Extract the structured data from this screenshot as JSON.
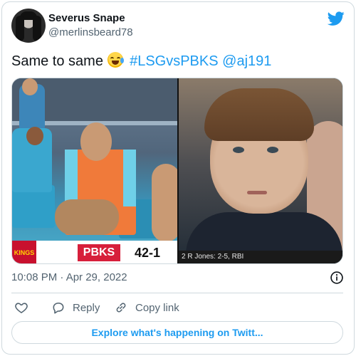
{
  "author": {
    "display_name": "Severus Snape",
    "handle": "@merlinsbeard78"
  },
  "tweet": {
    "text_prefix": "Same to same",
    "emoji": "face-with-tears-of-joy",
    "hashtag": "#LSGvsPBKS",
    "mention": "@aj191"
  },
  "media": {
    "left": {
      "logo_text": "KINGS",
      "team": "PBKS",
      "score": "42-1"
    },
    "right": {
      "stat_text": "2 R  Jones: 2-5, RBI"
    }
  },
  "meta": {
    "timestamp": "10:08 PM · Apr 29, 2022"
  },
  "actions": {
    "reply_label": "Reply",
    "copy_link_label": "Copy link"
  },
  "footer": {
    "explore_label": "Explore what's happening on Twitt..."
  },
  "colors": {
    "accent": "#1d9bf0",
    "secondary_text": "#536471",
    "border": "#cfd9de"
  },
  "icons": [
    "twitter-bird-icon",
    "info-icon",
    "heart-icon",
    "reply-icon",
    "link-icon"
  ]
}
